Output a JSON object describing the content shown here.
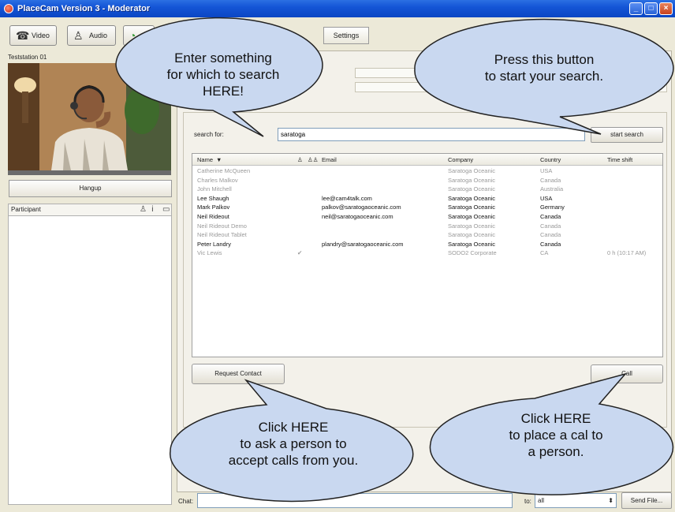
{
  "window": {
    "title": "PlaceCam Version 3 - Moderator",
    "min_icon": "minimize-icon",
    "max_icon": "maximize-icon",
    "close_icon": "close-icon"
  },
  "toolbar": {
    "video_label": "Video",
    "audio_label": "Audio",
    "settings_tab": "Settings"
  },
  "left": {
    "station": "Teststation 01",
    "hangup": "Hangup",
    "participant_header": "Participant"
  },
  "search": {
    "label": "search for:",
    "value": "saratoga",
    "button": "start search"
  },
  "table": {
    "headers": {
      "name": "Name",
      "email": "Email",
      "company": "Company",
      "country": "Country",
      "timeshift": "Time shift"
    },
    "rows": [
      {
        "name": "Catherine McQueen",
        "check": "",
        "email": "",
        "company": "Saratoga Oceanic",
        "country": "USA",
        "timeshift": "",
        "active": false
      },
      {
        "name": "Charles Malkov",
        "check": "",
        "email": "",
        "company": "Saratoga Oceanic",
        "country": "Canada",
        "timeshift": "",
        "active": false
      },
      {
        "name": "John Mitchell",
        "check": "",
        "email": "",
        "company": "Saratoga Oceanic",
        "country": "Australia",
        "timeshift": "",
        "active": false
      },
      {
        "name": "Lee Shaugh",
        "check": "",
        "email": "lee@cam4talk.com",
        "company": "Saratoga Oceanic",
        "country": "USA",
        "timeshift": "",
        "active": true
      },
      {
        "name": "Mark Palkov",
        "check": "",
        "email": "palkov@saratogaoceanic.com",
        "company": "Saratoga Oceanic",
        "country": "Germany",
        "timeshift": "",
        "active": true
      },
      {
        "name": "Neil Rideout",
        "check": "",
        "email": "neil@saratogaoceanic.com",
        "company": "Saratoga Oceanic",
        "country": "Canada",
        "timeshift": "",
        "active": true
      },
      {
        "name": "Neil Rideout Demo",
        "check": "",
        "email": "",
        "company": "Saratoga Oceanic",
        "country": "Canada",
        "timeshift": "",
        "active": false
      },
      {
        "name": "Neil Rideout Tablet",
        "check": "",
        "email": "",
        "company": "Saratoga Oceanic",
        "country": "Canada",
        "timeshift": "",
        "active": false
      },
      {
        "name": "Peter Landry",
        "check": "",
        "email": "plandry@saratogaoceanic.com",
        "company": "Saratoga Oceanic",
        "country": "Canada",
        "timeshift": "",
        "active": true
      },
      {
        "name": "Vic Lewis",
        "check": "✔",
        "email": "",
        "company": "SODO2 Corporate",
        "country": "CA",
        "timeshift": "0 h (10:17 AM)",
        "active": false
      }
    ]
  },
  "actions": {
    "request": "Request Contact",
    "call": "Call"
  },
  "chat": {
    "label": "Chat:",
    "to_label": "to:",
    "to_value": "all",
    "send": "Send File..."
  },
  "bubbles": {
    "search": [
      "Enter something",
      "for which to search",
      "HERE!"
    ],
    "start": [
      "Press this button",
      "to start your search."
    ],
    "request": [
      "Click HERE",
      "to ask a person to",
      "accept calls from you."
    ],
    "call": [
      "Click HERE",
      "to place a cal to",
      "a person."
    ]
  },
  "colors": {
    "bubble_fill": "#c9d8f0",
    "bubble_stroke": "#222222",
    "titlebar": "#1455d6"
  }
}
